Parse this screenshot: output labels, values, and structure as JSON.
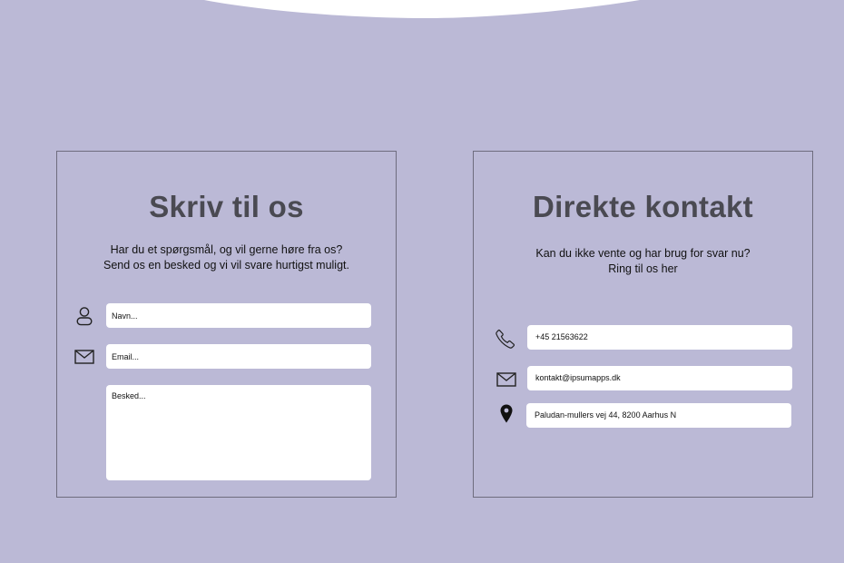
{
  "colors": {
    "background": "#bbb9d6",
    "title": "#4a4a52",
    "field": "#ffffff",
    "border": "#6e6c7e"
  },
  "write_panel": {
    "title": "Skriv til os",
    "description": [
      "Har du et spørgsmål, og vil gerne høre fra os?",
      "Send os en besked og vi vil svare hurtigst muligt."
    ],
    "name_placeholder": "Navn...",
    "email_placeholder": "Email...",
    "message_placeholder": "Besked...",
    "icons": {
      "name": "person-icon",
      "email": "envelope-icon"
    }
  },
  "contact_panel": {
    "title": "Direkte kontakt",
    "description": [
      "Kan du ikke vente og har brug for svar nu?",
      "Ring til os her"
    ],
    "phone": "+45 21563622",
    "email": "kontakt@ipsumapps.dk",
    "address": "Paludan-mullers vej 44, 8200 Aarhus N",
    "icons": {
      "phone": "phone-icon",
      "email": "envelope-icon",
      "address": "map-pin-icon"
    }
  }
}
